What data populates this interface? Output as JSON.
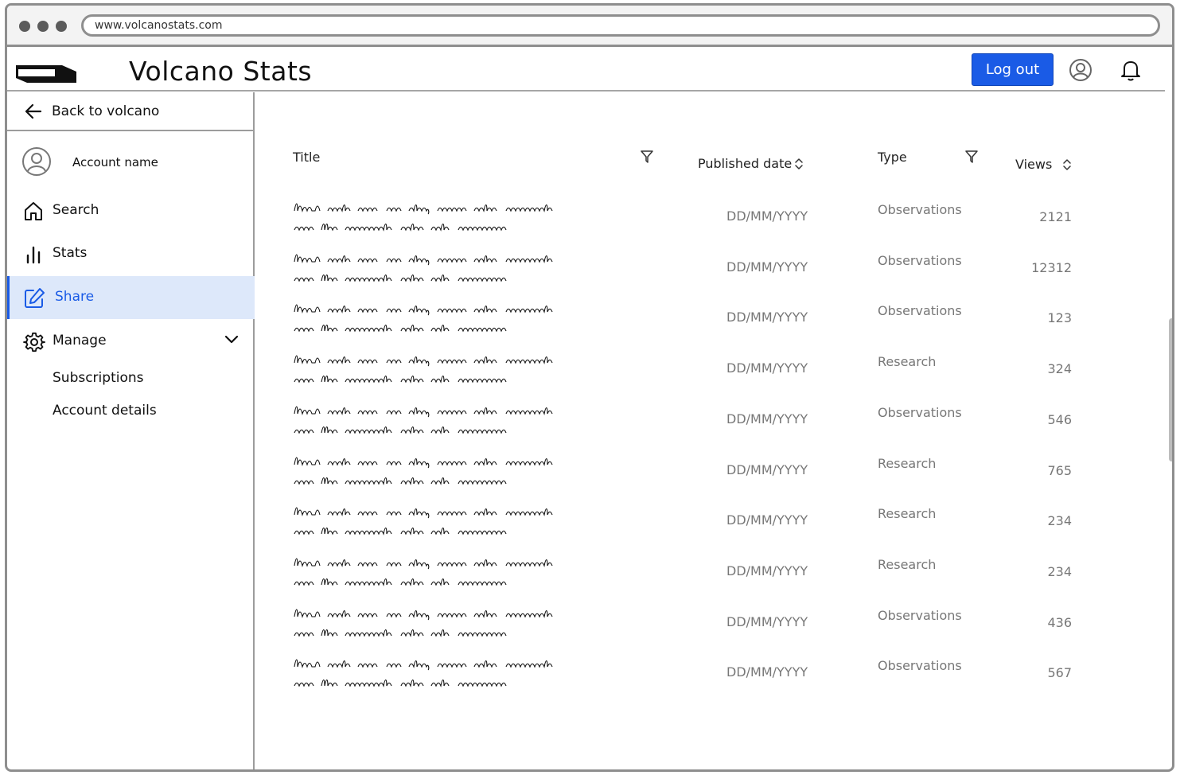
{
  "browser": {
    "url": "www.volcanostats.com"
  },
  "header": {
    "title": "Volcano Stats",
    "logout_label": "Log out"
  },
  "sidebar": {
    "back_label": "Back to volcano",
    "account_name": "Account name",
    "items": [
      {
        "label": "Search",
        "icon": "home-icon"
      },
      {
        "label": "Stats",
        "icon": "bar-chart-icon"
      },
      {
        "label": "Share",
        "icon": "edit-icon",
        "active": true
      },
      {
        "label": "Manage",
        "icon": "gear-icon"
      }
    ],
    "sub_items": [
      {
        "label": "Subscriptions"
      },
      {
        "label": "Account details"
      }
    ]
  },
  "table": {
    "headers": {
      "title": "Title",
      "date": "Published date",
      "type": "Type",
      "views": "Views"
    },
    "rows": [
      {
        "date": "DD/MM/YYYY",
        "type": "Observations",
        "views": "2121"
      },
      {
        "date": "DD/MM/YYYY",
        "type": "Observations",
        "views": "12312"
      },
      {
        "date": "DD/MM/YYYY",
        "type": "Observations",
        "views": "123"
      },
      {
        "date": "DD/MM/YYYY",
        "type": "Research",
        "views": "324"
      },
      {
        "date": "DD/MM/YYYY",
        "type": "Observations",
        "views": "546"
      },
      {
        "date": "DD/MM/YYYY",
        "type": "Research",
        "views": "765"
      },
      {
        "date": "DD/MM/YYYY",
        "type": "Research",
        "views": "234"
      },
      {
        "date": "DD/MM/YYYY",
        "type": "Research",
        "views": "234"
      },
      {
        "date": "DD/MM/YYYY",
        "type": "Observations",
        "views": "436"
      },
      {
        "date": "DD/MM/YYYY",
        "type": "Observations",
        "views": "567"
      }
    ]
  },
  "colors": {
    "accent": "#1a5be6",
    "active_bg": "#dde8fa"
  }
}
